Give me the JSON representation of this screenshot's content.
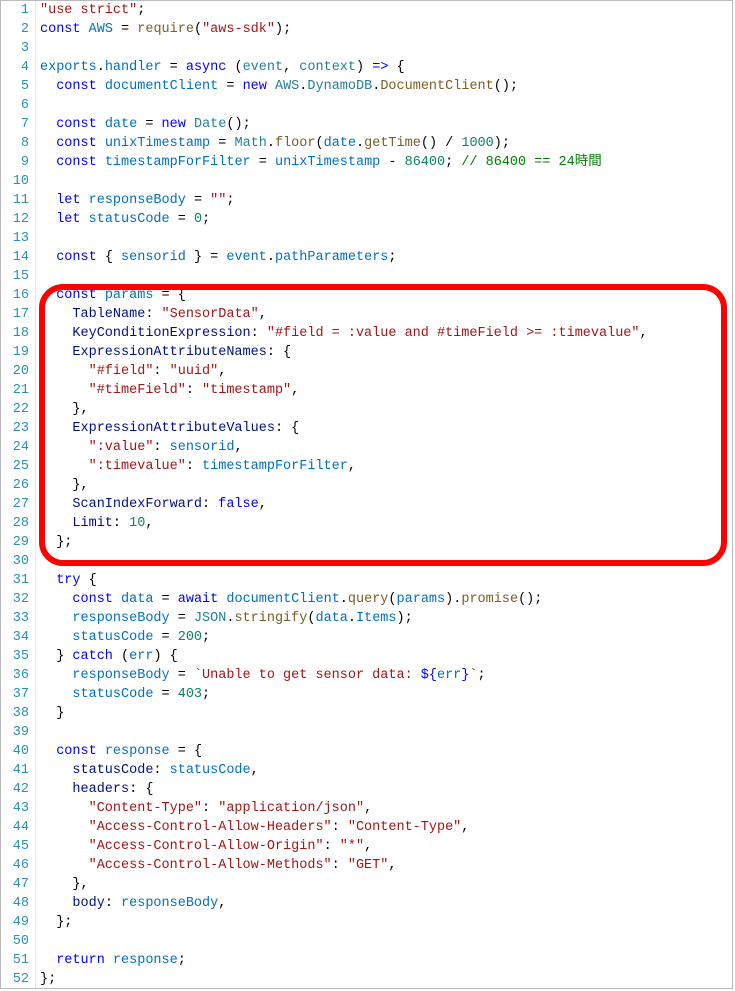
{
  "lineCount": 52,
  "highlight": {
    "startLine": 16,
    "endLine": 29
  },
  "lines": [
    [
      [
        "c-str",
        "\"use strict\""
      ],
      [
        "c-punc",
        ";"
      ]
    ],
    [
      [
        "c-kw",
        "const"
      ],
      [
        "c-punc",
        " "
      ],
      [
        "c-var",
        "AWS"
      ],
      [
        "c-punc",
        " = "
      ],
      [
        "c-fn",
        "require"
      ],
      [
        "c-punc",
        "("
      ],
      [
        "c-str",
        "\"aws-sdk\""
      ],
      [
        "c-punc",
        ");"
      ]
    ],
    [],
    [
      [
        "c-var",
        "exports"
      ],
      [
        "c-punc",
        "."
      ],
      [
        "c-var",
        "handler"
      ],
      [
        "c-punc",
        " = "
      ],
      [
        "c-kw",
        "async"
      ],
      [
        "c-punc",
        " ("
      ],
      [
        "c-param",
        "event"
      ],
      [
        "c-punc",
        ", "
      ],
      [
        "c-param",
        "context"
      ],
      [
        "c-punc",
        ") "
      ],
      [
        "c-kw",
        "=>"
      ],
      [
        "c-punc",
        " {"
      ]
    ],
    [
      [
        "c-punc",
        "  "
      ],
      [
        "c-kw",
        "const"
      ],
      [
        "c-punc",
        " "
      ],
      [
        "c-var",
        "documentClient"
      ],
      [
        "c-punc",
        " = "
      ],
      [
        "c-kw",
        "new"
      ],
      [
        "c-punc",
        " "
      ],
      [
        "c-cls",
        "AWS"
      ],
      [
        "c-punc",
        "."
      ],
      [
        "c-cls",
        "DynamoDB"
      ],
      [
        "c-punc",
        "."
      ],
      [
        "c-fn",
        "DocumentClient"
      ],
      [
        "c-punc",
        "();"
      ]
    ],
    [],
    [
      [
        "c-punc",
        "  "
      ],
      [
        "c-kw",
        "const"
      ],
      [
        "c-punc",
        " "
      ],
      [
        "c-var",
        "date"
      ],
      [
        "c-punc",
        " = "
      ],
      [
        "c-kw",
        "new"
      ],
      [
        "c-punc",
        " "
      ],
      [
        "c-cls",
        "Date"
      ],
      [
        "c-punc",
        "();"
      ]
    ],
    [
      [
        "c-punc",
        "  "
      ],
      [
        "c-kw",
        "const"
      ],
      [
        "c-punc",
        " "
      ],
      [
        "c-var",
        "unixTimestamp"
      ],
      [
        "c-punc",
        " = "
      ],
      [
        "c-cls",
        "Math"
      ],
      [
        "c-punc",
        "."
      ],
      [
        "c-fn",
        "floor"
      ],
      [
        "c-punc",
        "("
      ],
      [
        "c-var",
        "date"
      ],
      [
        "c-punc",
        "."
      ],
      [
        "c-fn",
        "getTime"
      ],
      [
        "c-punc",
        "() / "
      ],
      [
        "c-num",
        "1000"
      ],
      [
        "c-punc",
        ");"
      ]
    ],
    [
      [
        "c-punc",
        "  "
      ],
      [
        "c-kw",
        "const"
      ],
      [
        "c-punc",
        " "
      ],
      [
        "c-var",
        "timestampForFilter"
      ],
      [
        "c-punc",
        " = "
      ],
      [
        "c-var",
        "unixTimestamp"
      ],
      [
        "c-punc",
        " - "
      ],
      [
        "c-num",
        "86400"
      ],
      [
        "c-punc",
        "; "
      ],
      [
        "c-com",
        "// 86400 == 24時間"
      ]
    ],
    [],
    [
      [
        "c-punc",
        "  "
      ],
      [
        "c-kw",
        "let"
      ],
      [
        "c-punc",
        " "
      ],
      [
        "c-var",
        "responseBody"
      ],
      [
        "c-punc",
        " = "
      ],
      [
        "c-str",
        "\"\""
      ],
      [
        "c-punc",
        ";"
      ]
    ],
    [
      [
        "c-punc",
        "  "
      ],
      [
        "c-kw",
        "let"
      ],
      [
        "c-punc",
        " "
      ],
      [
        "c-var",
        "statusCode"
      ],
      [
        "c-punc",
        " = "
      ],
      [
        "c-num",
        "0"
      ],
      [
        "c-punc",
        ";"
      ]
    ],
    [],
    [
      [
        "c-punc",
        "  "
      ],
      [
        "c-kw",
        "const"
      ],
      [
        "c-punc",
        " { "
      ],
      [
        "c-var",
        "sensorid"
      ],
      [
        "c-punc",
        " } = "
      ],
      [
        "c-var",
        "event"
      ],
      [
        "c-punc",
        "."
      ],
      [
        "c-var",
        "pathParameters"
      ],
      [
        "c-punc",
        ";"
      ]
    ],
    [],
    [
      [
        "c-punc",
        "  "
      ],
      [
        "c-kw",
        "const"
      ],
      [
        "c-punc",
        " "
      ],
      [
        "c-var",
        "params"
      ],
      [
        "c-punc",
        " = {"
      ]
    ],
    [
      [
        "c-punc",
        "    "
      ],
      [
        "c-prop",
        "TableName"
      ],
      [
        "c-punc",
        ": "
      ],
      [
        "c-str",
        "\"SensorData\""
      ],
      [
        "c-punc",
        ","
      ]
    ],
    [
      [
        "c-punc",
        "    "
      ],
      [
        "c-prop",
        "KeyConditionExpression"
      ],
      [
        "c-punc",
        ": "
      ],
      [
        "c-str",
        "\"#field = :value and #timeField >= :timevalue\""
      ],
      [
        "c-punc",
        ","
      ]
    ],
    [
      [
        "c-punc",
        "    "
      ],
      [
        "c-prop",
        "ExpressionAttributeNames"
      ],
      [
        "c-punc",
        ": {"
      ]
    ],
    [
      [
        "c-punc",
        "      "
      ],
      [
        "c-str",
        "\"#field\""
      ],
      [
        "c-punc",
        ": "
      ],
      [
        "c-str",
        "\"uuid\""
      ],
      [
        "c-punc",
        ","
      ]
    ],
    [
      [
        "c-punc",
        "      "
      ],
      [
        "c-str",
        "\"#timeField\""
      ],
      [
        "c-punc",
        ": "
      ],
      [
        "c-str",
        "\"timestamp\""
      ],
      [
        "c-punc",
        ","
      ]
    ],
    [
      [
        "c-punc",
        "    },"
      ]
    ],
    [
      [
        "c-punc",
        "    "
      ],
      [
        "c-prop",
        "ExpressionAttributeValues"
      ],
      [
        "c-punc",
        ": {"
      ]
    ],
    [
      [
        "c-punc",
        "      "
      ],
      [
        "c-str",
        "\":value\""
      ],
      [
        "c-punc",
        ": "
      ],
      [
        "c-var",
        "sensorid"
      ],
      [
        "c-punc",
        ","
      ]
    ],
    [
      [
        "c-punc",
        "      "
      ],
      [
        "c-str",
        "\":timevalue\""
      ],
      [
        "c-punc",
        ": "
      ],
      [
        "c-var",
        "timestampForFilter"
      ],
      [
        "c-punc",
        ","
      ]
    ],
    [
      [
        "c-punc",
        "    },"
      ]
    ],
    [
      [
        "c-punc",
        "    "
      ],
      [
        "c-prop",
        "ScanIndexForward"
      ],
      [
        "c-punc",
        ": "
      ],
      [
        "c-const",
        "false"
      ],
      [
        "c-punc",
        ","
      ]
    ],
    [
      [
        "c-punc",
        "    "
      ],
      [
        "c-prop",
        "Limit"
      ],
      [
        "c-punc",
        ": "
      ],
      [
        "c-num",
        "10"
      ],
      [
        "c-punc",
        ","
      ]
    ],
    [
      [
        "c-punc",
        "  };"
      ]
    ],
    [],
    [
      [
        "c-punc",
        "  "
      ],
      [
        "c-kw",
        "try"
      ],
      [
        "c-punc",
        " {"
      ]
    ],
    [
      [
        "c-punc",
        "    "
      ],
      [
        "c-kw",
        "const"
      ],
      [
        "c-punc",
        " "
      ],
      [
        "c-var",
        "data"
      ],
      [
        "c-punc",
        " = "
      ],
      [
        "c-kw",
        "await"
      ],
      [
        "c-punc",
        " "
      ],
      [
        "c-var",
        "documentClient"
      ],
      [
        "c-punc",
        "."
      ],
      [
        "c-fn",
        "query"
      ],
      [
        "c-punc",
        "("
      ],
      [
        "c-var",
        "params"
      ],
      [
        "c-punc",
        ")."
      ],
      [
        "c-fn",
        "promise"
      ],
      [
        "c-punc",
        "();"
      ]
    ],
    [
      [
        "c-punc",
        "    "
      ],
      [
        "c-var",
        "responseBody"
      ],
      [
        "c-punc",
        " = "
      ],
      [
        "c-cls",
        "JSON"
      ],
      [
        "c-punc",
        "."
      ],
      [
        "c-fn",
        "stringify"
      ],
      [
        "c-punc",
        "("
      ],
      [
        "c-var",
        "data"
      ],
      [
        "c-punc",
        "."
      ],
      [
        "c-var",
        "Items"
      ],
      [
        "c-punc",
        ");"
      ]
    ],
    [
      [
        "c-punc",
        "    "
      ],
      [
        "c-var",
        "statusCode"
      ],
      [
        "c-punc",
        " = "
      ],
      [
        "c-num",
        "200"
      ],
      [
        "c-punc",
        ";"
      ]
    ],
    [
      [
        "c-punc",
        "  } "
      ],
      [
        "c-kw",
        "catch"
      ],
      [
        "c-punc",
        " ("
      ],
      [
        "c-var",
        "err"
      ],
      [
        "c-punc",
        ") {"
      ]
    ],
    [
      [
        "c-punc",
        "    "
      ],
      [
        "c-var",
        "responseBody"
      ],
      [
        "c-punc",
        " = "
      ],
      [
        "c-str",
        "`Unable to get sensor data: "
      ],
      [
        "c-kw",
        "${"
      ],
      [
        "c-var",
        "err"
      ],
      [
        "c-kw",
        "}"
      ],
      [
        "c-str",
        "`"
      ],
      [
        "c-punc",
        ";"
      ]
    ],
    [
      [
        "c-punc",
        "    "
      ],
      [
        "c-var",
        "statusCode"
      ],
      [
        "c-punc",
        " = "
      ],
      [
        "c-num",
        "403"
      ],
      [
        "c-punc",
        ";"
      ]
    ],
    [
      [
        "c-punc",
        "  }"
      ]
    ],
    [],
    [
      [
        "c-punc",
        "  "
      ],
      [
        "c-kw",
        "const"
      ],
      [
        "c-punc",
        " "
      ],
      [
        "c-var",
        "response"
      ],
      [
        "c-punc",
        " = {"
      ]
    ],
    [
      [
        "c-punc",
        "    "
      ],
      [
        "c-prop",
        "statusCode"
      ],
      [
        "c-punc",
        ": "
      ],
      [
        "c-var",
        "statusCode"
      ],
      [
        "c-punc",
        ","
      ]
    ],
    [
      [
        "c-punc",
        "    "
      ],
      [
        "c-prop",
        "headers"
      ],
      [
        "c-punc",
        ": {"
      ]
    ],
    [
      [
        "c-punc",
        "      "
      ],
      [
        "c-str",
        "\"Content-Type\""
      ],
      [
        "c-punc",
        ": "
      ],
      [
        "c-str",
        "\"application/json\""
      ],
      [
        "c-punc",
        ","
      ]
    ],
    [
      [
        "c-punc",
        "      "
      ],
      [
        "c-str",
        "\"Access-Control-Allow-Headers\""
      ],
      [
        "c-punc",
        ": "
      ],
      [
        "c-str",
        "\"Content-Type\""
      ],
      [
        "c-punc",
        ","
      ]
    ],
    [
      [
        "c-punc",
        "      "
      ],
      [
        "c-str",
        "\"Access-Control-Allow-Origin\""
      ],
      [
        "c-punc",
        ": "
      ],
      [
        "c-str",
        "\"*\""
      ],
      [
        "c-punc",
        ","
      ]
    ],
    [
      [
        "c-punc",
        "      "
      ],
      [
        "c-str",
        "\"Access-Control-Allow-Methods\""
      ],
      [
        "c-punc",
        ": "
      ],
      [
        "c-str",
        "\"GET\""
      ],
      [
        "c-punc",
        ","
      ]
    ],
    [
      [
        "c-punc",
        "    },"
      ]
    ],
    [
      [
        "c-punc",
        "    "
      ],
      [
        "c-prop",
        "body"
      ],
      [
        "c-punc",
        ": "
      ],
      [
        "c-var",
        "responseBody"
      ],
      [
        "c-punc",
        ","
      ]
    ],
    [
      [
        "c-punc",
        "  };"
      ]
    ],
    [],
    [
      [
        "c-punc",
        "  "
      ],
      [
        "c-kw",
        "return"
      ],
      [
        "c-punc",
        " "
      ],
      [
        "c-var",
        "response"
      ],
      [
        "c-punc",
        ";"
      ]
    ],
    [
      [
        "c-punc",
        "};"
      ]
    ]
  ]
}
